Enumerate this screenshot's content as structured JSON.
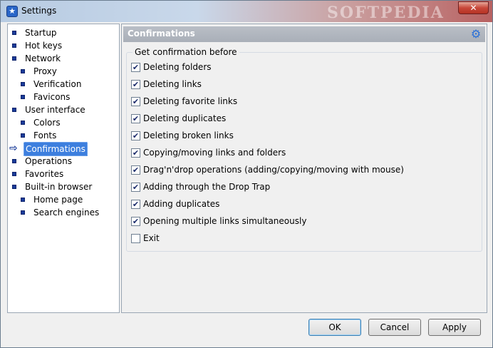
{
  "window": {
    "title": "Settings",
    "watermark": "SOFTPEDIA",
    "close_glyph": "✕"
  },
  "tree": {
    "items": [
      {
        "label": "Startup",
        "level": 0
      },
      {
        "label": "Hot keys",
        "level": 0
      },
      {
        "label": "Network",
        "level": 0
      },
      {
        "label": "Proxy",
        "level": 1
      },
      {
        "label": "Verification",
        "level": 1
      },
      {
        "label": "Favicons",
        "level": 1
      },
      {
        "label": "User interface",
        "level": 0
      },
      {
        "label": "Colors",
        "level": 1
      },
      {
        "label": "Fonts",
        "level": 1
      },
      {
        "label": "Confirmations",
        "level": 0,
        "selected": true
      },
      {
        "label": "Operations",
        "level": 0
      },
      {
        "label": "Favorites",
        "level": 0
      },
      {
        "label": "Built-in browser",
        "level": 0
      },
      {
        "label": "Home page",
        "level": 1
      },
      {
        "label": "Search engines",
        "level": 1
      }
    ]
  },
  "panel": {
    "title": "Confirmations",
    "group_label": "Get confirmation before",
    "options": [
      {
        "label": "Deleting folders",
        "checked": true
      },
      {
        "label": "Deleting links",
        "checked": true
      },
      {
        "label": "Deleting favorite links",
        "checked": true
      },
      {
        "label": "Deleting duplicates",
        "checked": true
      },
      {
        "label": "Deleting broken links",
        "checked": true
      },
      {
        "label": "Copying/moving links and folders",
        "checked": true
      },
      {
        "label": "Drag'n'drop operations (adding/copying/moving with mouse)",
        "checked": true
      },
      {
        "label": "Adding through the Drop Trap",
        "checked": true
      },
      {
        "label": "Adding duplicates",
        "checked": true
      },
      {
        "label": "Opening multiple links simultaneously",
        "checked": true
      },
      {
        "label": "Exit",
        "checked": false
      }
    ]
  },
  "buttons": {
    "ok": "OK",
    "cancel": "Cancel",
    "apply": "Apply"
  },
  "icons": {
    "app": "star-icon",
    "gear": "gear-icon",
    "arrow": "arrow-right-icon"
  },
  "colors": {
    "selection": "#3d7fde",
    "bullet": "#1a3c9a"
  }
}
